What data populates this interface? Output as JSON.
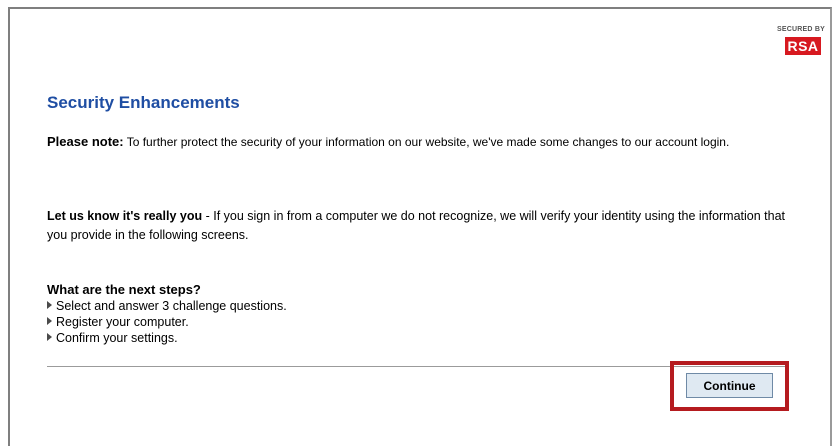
{
  "logo": {
    "secured_by": "SECURED BY",
    "brand": "RSA",
    "brand_color": "#d71920"
  },
  "title": "Security Enhancements",
  "note": {
    "lead": "Please note:",
    "text": " To further protect the security of your information on our website, we've made some changes to our account login."
  },
  "verify": {
    "lead": "Let us know it's really you",
    "text": " - If you sign in from a computer we do not recognize, we will verify your identity using the information that you provide in the following screens."
  },
  "steps": {
    "heading": "What are the next steps?",
    "items": [
      "Select and answer 3 challenge questions.",
      "Register your computer.",
      "Confirm your settings."
    ],
    "bullet_icon": "triangle-right-icon"
  },
  "actions": {
    "continue_label": "Continue"
  },
  "colors": {
    "title": "#1f4ea3",
    "highlight": "#b51b1f",
    "button_bg": "#dfe9f2"
  }
}
